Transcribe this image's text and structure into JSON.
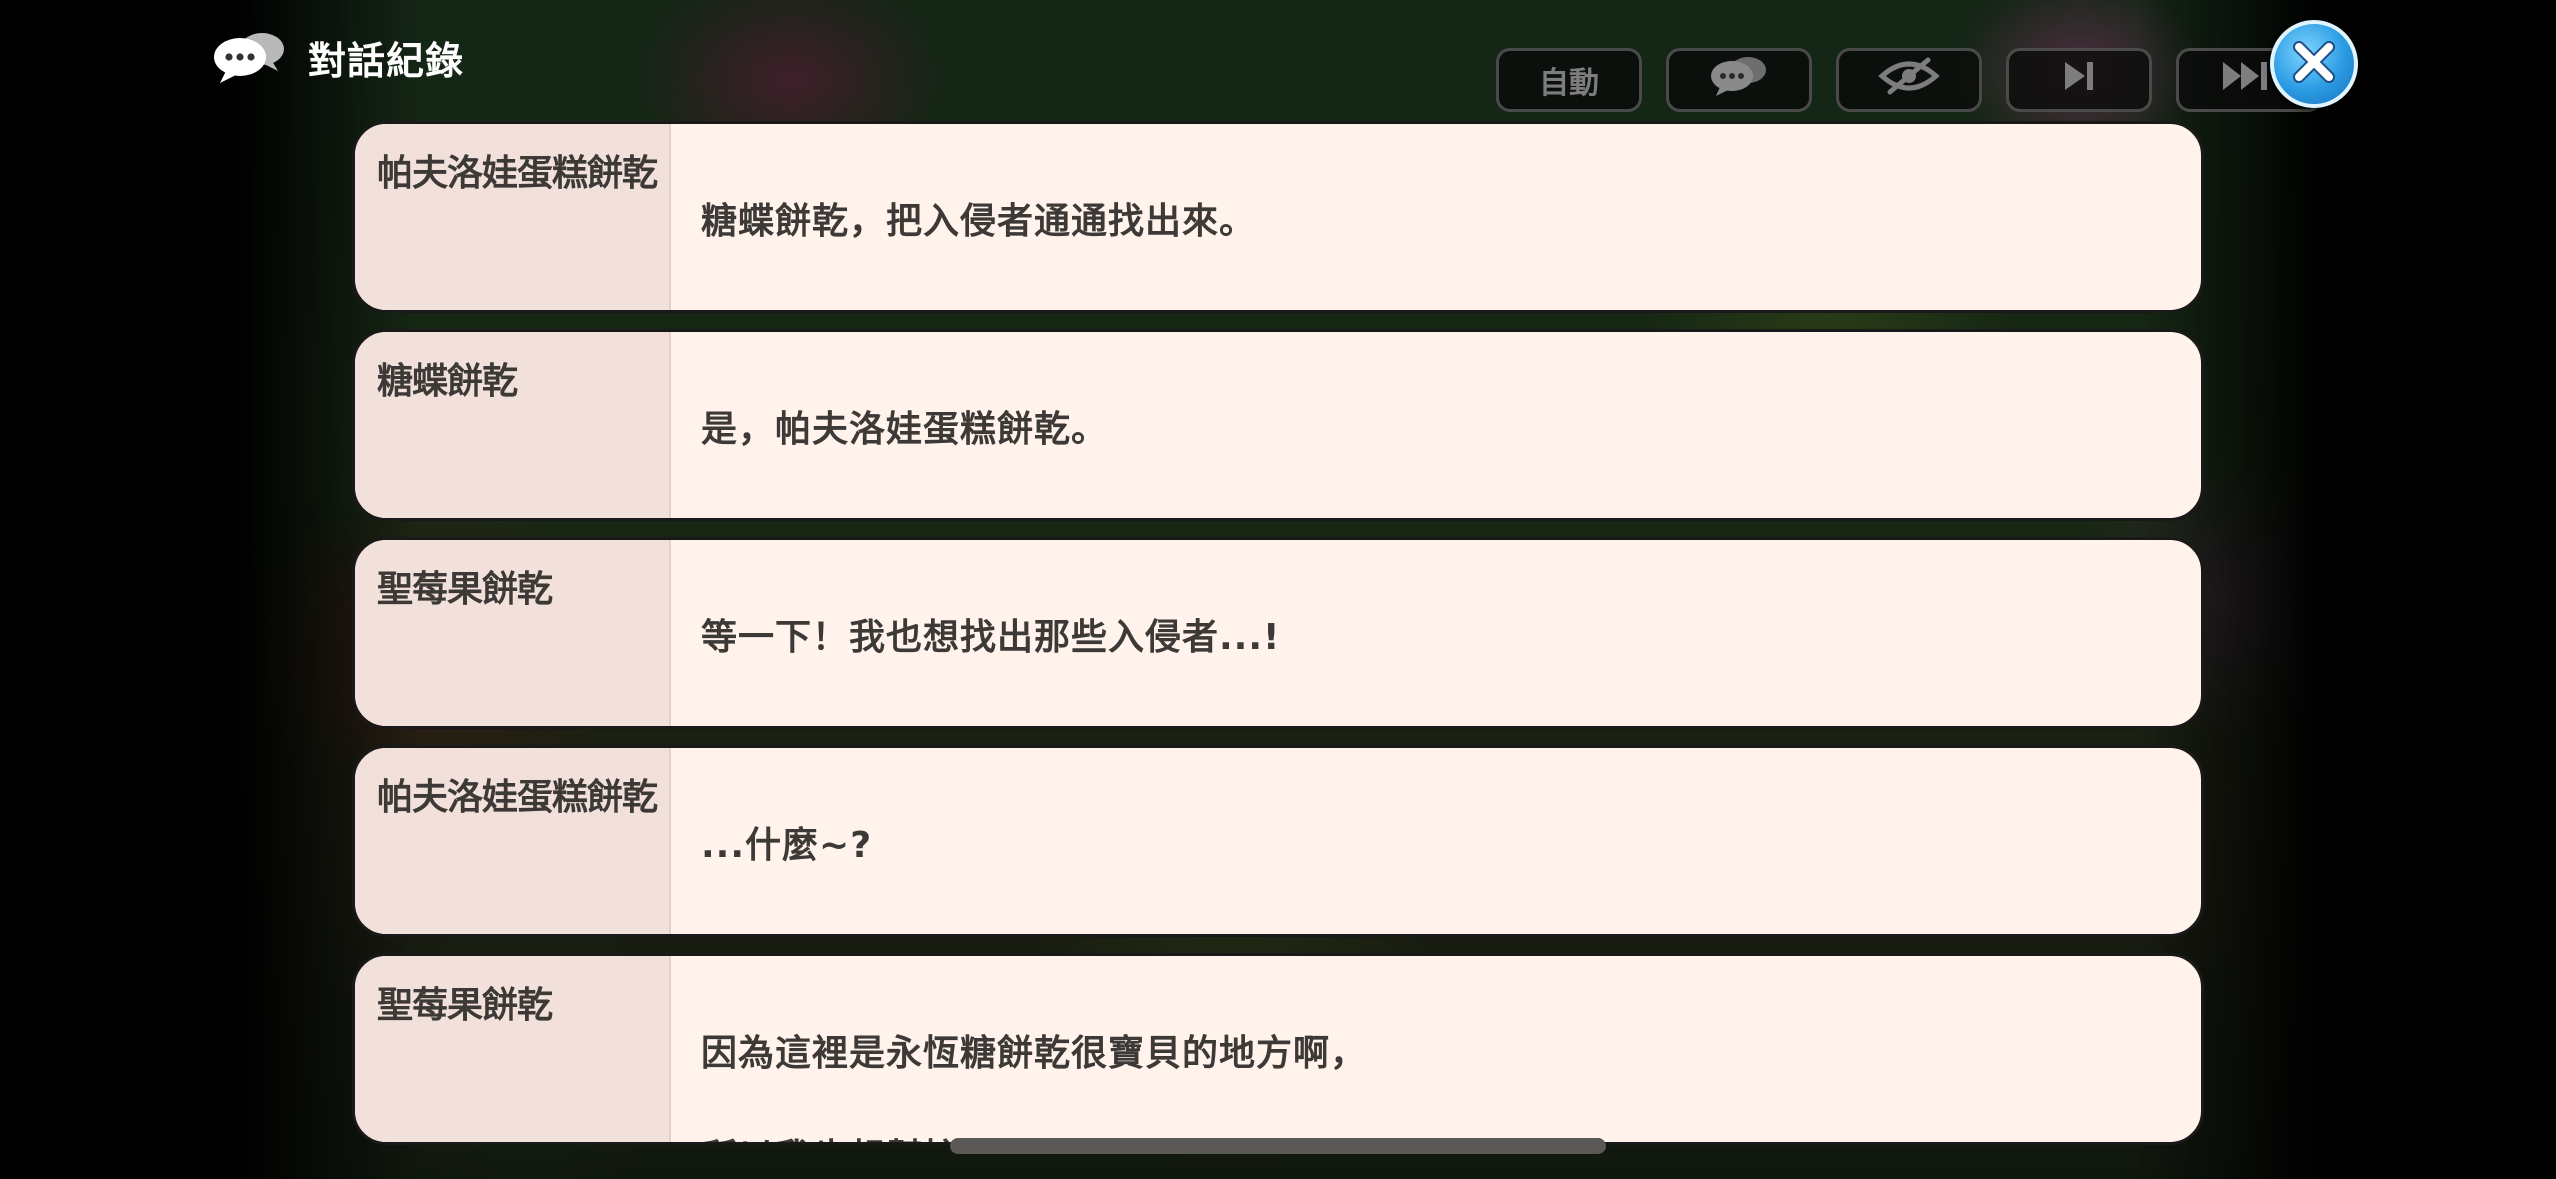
{
  "header": {
    "title": "對話紀錄",
    "icon": "chat-bubbles-icon"
  },
  "toolbar": {
    "auto_label": "自動",
    "buttons": [
      {
        "name": "auto-button",
        "icon": null
      },
      {
        "name": "dialogue-log-button",
        "icon": "chat-bubbles-icon"
      },
      {
        "name": "hide-ui-button",
        "icon": "eye-slash-icon"
      },
      {
        "name": "skip-next-button",
        "icon": "skip-next-icon"
      },
      {
        "name": "fast-forward-button",
        "icon": "fast-forward-icon"
      }
    ],
    "close_icon": "close-icon"
  },
  "colors": {
    "entry_bg": "#fff3ec",
    "speaker_bg": "#f2e1da",
    "text": "#3c3937",
    "close_button": "#2a9be3"
  },
  "log": [
    {
      "speaker": "帕夫洛娃蛋糕餅乾",
      "lines": [
        "糖蝶餅乾，把入侵者通通找出來。"
      ]
    },
    {
      "speaker": "糖蝶餅乾",
      "lines": [
        "是，帕夫洛娃蛋糕餅乾。"
      ]
    },
    {
      "speaker": "聖莓果餅乾",
      "lines": [
        "等一下！我也想找出那些入侵者...!"
      ]
    },
    {
      "speaker": "帕夫洛娃蛋糕餅乾",
      "lines": [
        "...什麼~?"
      ]
    },
    {
      "speaker": "聖莓果餅乾",
      "lines": [
        "因為這裡是永恆糖餅乾很寶貝的地方啊，",
        "所以我也想幫忙。"
      ]
    }
  ]
}
